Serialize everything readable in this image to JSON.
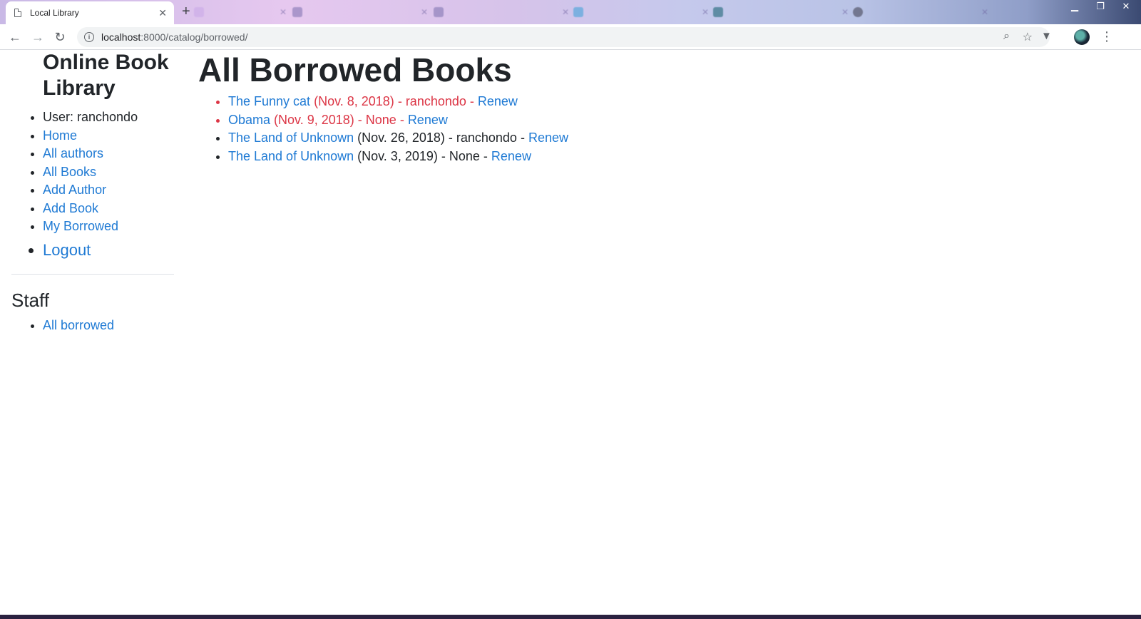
{
  "browser": {
    "tab_title": "Local Library",
    "tab_close": "✕",
    "new_tab": "+",
    "url_host": "localhost",
    "url_path": ":8000/catalog/borrowed/"
  },
  "sidebar": {
    "site_title": "Online Book Library",
    "user_label": "User: ranchondo",
    "items": [
      {
        "label": "Home"
      },
      {
        "label": "All authors"
      },
      {
        "label": "All Books"
      },
      {
        "label": "Add Author"
      },
      {
        "label": "Add Book"
      },
      {
        "label": "My Borrowed"
      }
    ],
    "logout_label": "Logout",
    "staff_title": "Staff",
    "staff_items": [
      {
        "label": "All borrowed"
      }
    ]
  },
  "main": {
    "title": "All Borrowed Books",
    "separator": " - ",
    "loans": [
      {
        "book": "The Funny cat",
        "due": "(Nov. 8, 2018)",
        "borrower": "ranchondo",
        "action": "Renew",
        "overdue": true
      },
      {
        "book": "Obama",
        "due": "(Nov. 9, 2018)",
        "borrower": "None",
        "action": "Renew",
        "overdue": true
      },
      {
        "book": "The Land of Unknown",
        "due": "(Nov. 26, 2018)",
        "borrower": "ranchondo",
        "action": "Renew",
        "overdue": false
      },
      {
        "book": "The Land of Unknown",
        "due": "(Nov. 3, 2019)",
        "borrower": "None",
        "action": "Renew",
        "overdue": false
      }
    ]
  },
  "colors": {
    "link": "#1f7ad4",
    "overdue": "#dc3545",
    "text": "#212529"
  }
}
